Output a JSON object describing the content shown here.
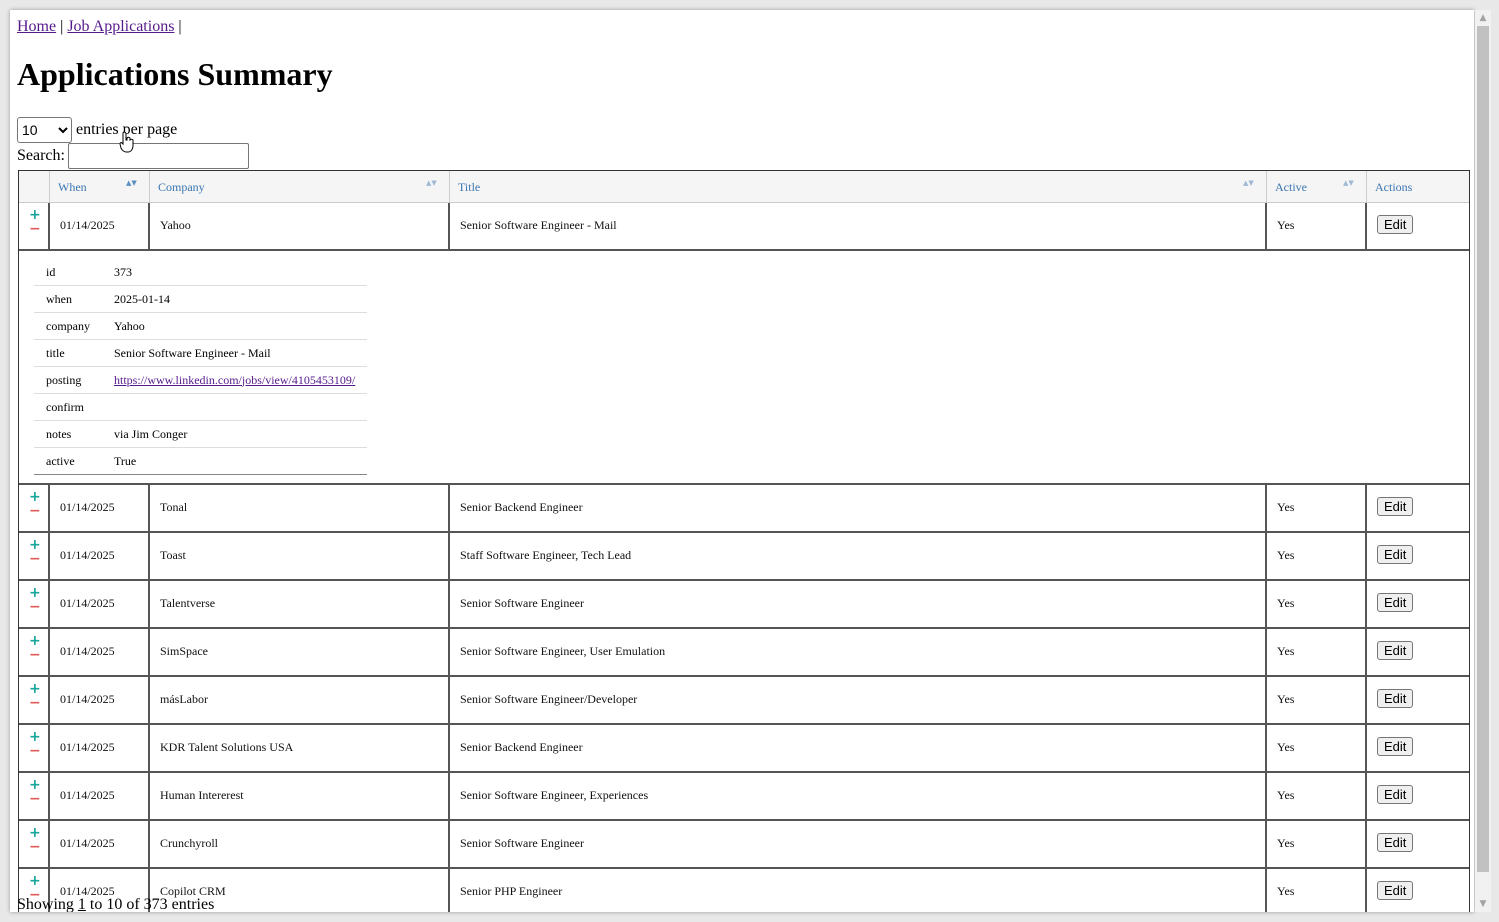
{
  "nav": {
    "home": "Home",
    "job_applications": "Job Applications",
    "separator": "|"
  },
  "page": {
    "title": "Applications Summary"
  },
  "length": {
    "selected": "10",
    "label": "entries per page"
  },
  "search": {
    "label": "Search:",
    "value": ""
  },
  "columns": [
    "When",
    "Company",
    "Title",
    "Active",
    "Actions"
  ],
  "expanded": {
    "rows": [
      {
        "key": "id",
        "value": "373"
      },
      {
        "key": "when",
        "value": "2025-01-14"
      },
      {
        "key": "company",
        "value": "Yahoo"
      },
      {
        "key": "title",
        "value": "Senior Software Engineer - Mail"
      },
      {
        "key": "posting",
        "value": "https://www.linkedin.com/jobs/view/4105453109/"
      },
      {
        "key": "confirm",
        "value": ""
      },
      {
        "key": "notes",
        "value": "via Jim Conger"
      },
      {
        "key": "active",
        "value": "True"
      }
    ]
  },
  "rows": [
    {
      "when": "01/14/2025",
      "company": "Yahoo",
      "title": "Senior Software Engineer - Mail",
      "active": "Yes",
      "action": "Edit"
    },
    {
      "when": "01/14/2025",
      "company": "Tonal",
      "title": "Senior Backend Engineer",
      "active": "Yes",
      "action": "Edit"
    },
    {
      "when": "01/14/2025",
      "company": "Toast",
      "title": "Staff Software Engineer, Tech Lead",
      "active": "Yes",
      "action": "Edit"
    },
    {
      "when": "01/14/2025",
      "company": "Talentverse",
      "title": "Senior Software Engineer",
      "active": "Yes",
      "action": "Edit"
    },
    {
      "when": "01/14/2025",
      "company": "SimSpace",
      "title": "Senior Software Engineer, User Emulation",
      "active": "Yes",
      "action": "Edit"
    },
    {
      "when": "01/14/2025",
      "company": "másLabor",
      "title": "Senior Software Engineer/Developer",
      "active": "Yes",
      "action": "Edit"
    },
    {
      "when": "01/14/2025",
      "company": "KDR Talent Solutions USA",
      "title": "Senior Backend Engineer",
      "active": "Yes",
      "action": "Edit"
    },
    {
      "when": "01/14/2025",
      "company": "Human Intererest",
      "title": "Senior Software Engineer, Experiences",
      "active": "Yes",
      "action": "Edit"
    },
    {
      "when": "01/14/2025",
      "company": "Crunchyroll",
      "title": "Senior Software Engineer",
      "active": "Yes",
      "action": "Edit"
    },
    {
      "when": "01/14/2025",
      "company": "Copilot CRM",
      "title": "Senior PHP Engineer",
      "active": "Yes",
      "action": "Edit"
    }
  ],
  "info": {
    "prefix": "Showing ",
    "start": "1",
    "suffix": " to 10 of 373 entries"
  },
  "icons": {
    "expand": "+",
    "collapse": "−",
    "sort": "▲▼",
    "scroll_up": "▲",
    "scroll_down": "▼"
  },
  "colors": {
    "link": "#551a8b",
    "header_text": "#3a76b0",
    "plus": "#1aa39a",
    "minus": "#e05a5a"
  }
}
